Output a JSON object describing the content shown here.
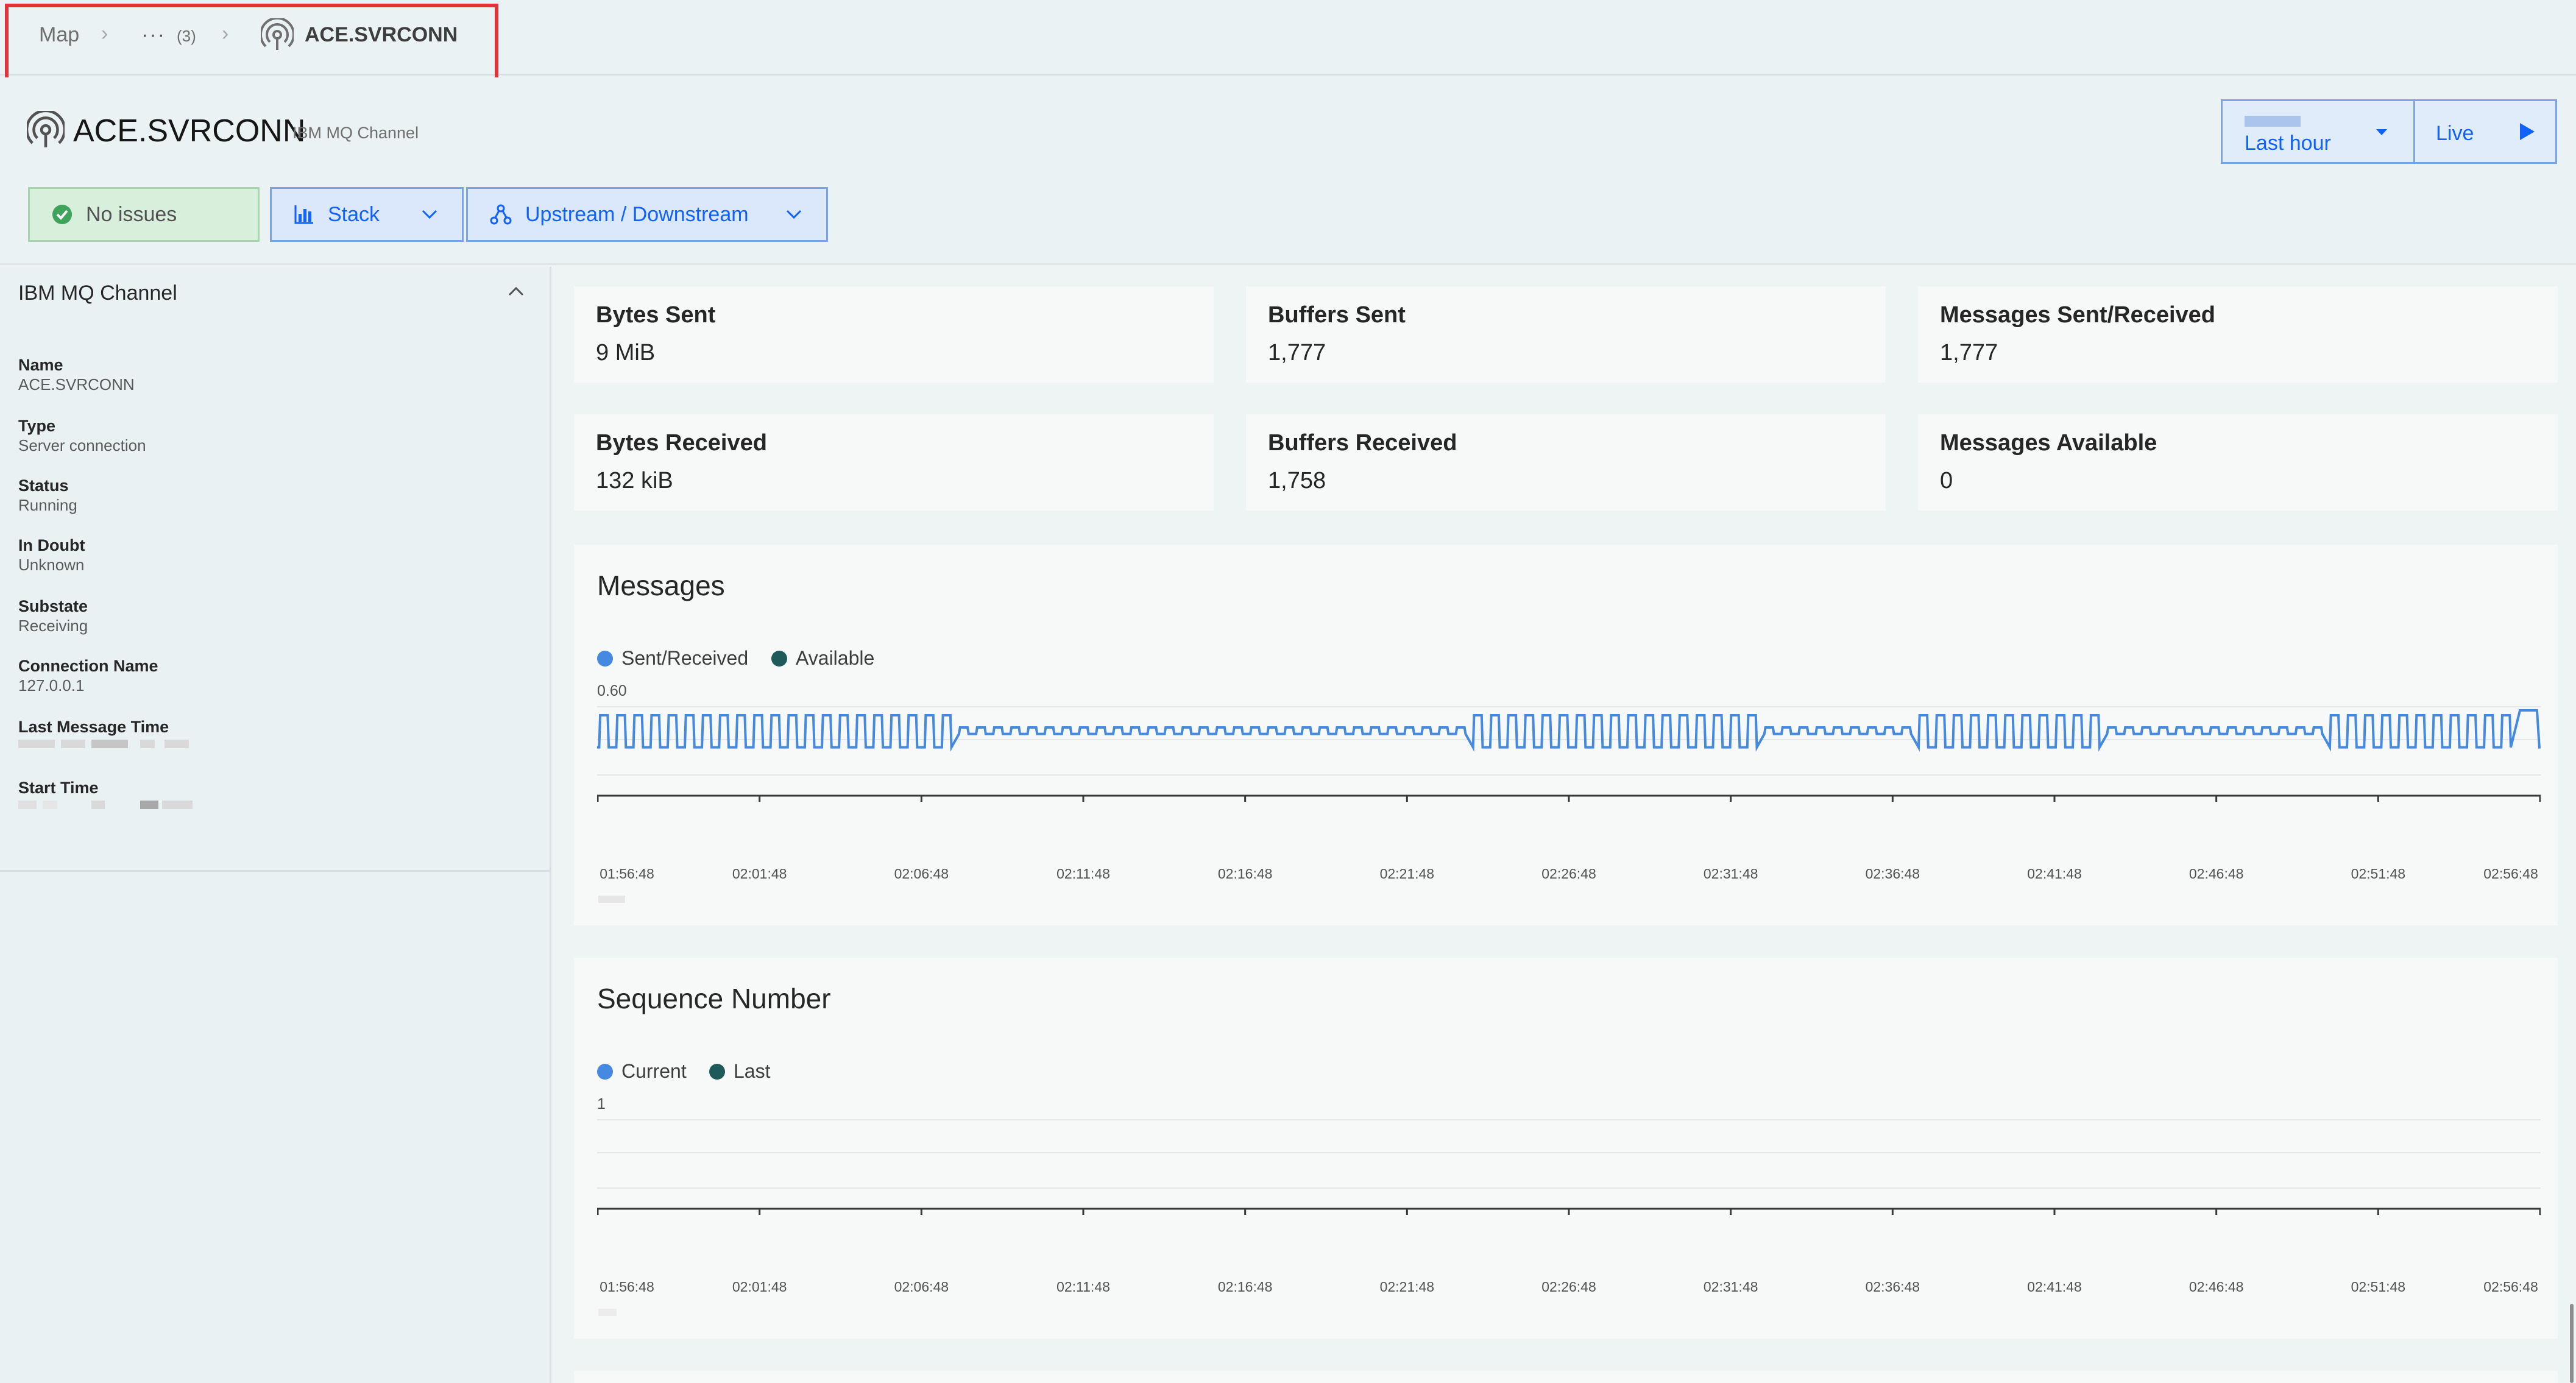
{
  "breadcrumb": {
    "root": "Map",
    "ellipsis": "···",
    "hidden_count": "(3)",
    "current": "ACE.SVRCONN"
  },
  "header": {
    "title": "ACE.SVRCONN",
    "entity_type": "IBM MQ Channel",
    "status_label": "No issues",
    "stack_label": "Stack",
    "updown_label": "Upstream / Downstream",
    "timeframe_label": "Last hour",
    "live_label": "Live"
  },
  "sidebar": {
    "section_title": "IBM MQ Channel",
    "properties": [
      {
        "label": "Name",
        "value": "ACE.SVRCONN"
      },
      {
        "label": "Type",
        "value": "Server connection"
      },
      {
        "label": "Status",
        "value": "Running"
      },
      {
        "label": "In Doubt",
        "value": "Unknown"
      },
      {
        "label": "Substate",
        "value": "Receiving"
      },
      {
        "label": "Connection Name",
        "value": "127.0.0.1"
      },
      {
        "label": "Last Message Time",
        "value": ""
      },
      {
        "label": "Start Time",
        "value": ""
      }
    ]
  },
  "metrics": [
    {
      "label": "Bytes Sent",
      "value": "9 MiB"
    },
    {
      "label": "Buffers Sent",
      "value": "1,777"
    },
    {
      "label": "Messages Sent/Received",
      "value": "1,777"
    },
    {
      "label": "Bytes Received",
      "value": "132 kiB"
    },
    {
      "label": "Buffers Received",
      "value": "1,758"
    },
    {
      "label": "Messages Available",
      "value": "0"
    }
  ],
  "colors": {
    "series_blue": "#4589e0",
    "series_teal": "#1f5a5a",
    "accent_blue": "#0f62fe",
    "ok_green": "#3fa35b",
    "highlight_red": "#e0343a"
  },
  "chart_data": [
    {
      "type": "line",
      "title": "Messages",
      "legend": [
        "Sent/Received",
        "Available"
      ],
      "y_tick_label": "0.60",
      "ylim": [
        0,
        0.6
      ],
      "x_ticks": [
        "01:56:48",
        "02:01:48",
        "02:06:48",
        "02:11:48",
        "02:16:48",
        "02:21:48",
        "02:26:48",
        "02:31:48",
        "02:36:48",
        "02:41:48",
        "02:46:48",
        "02:51:48",
        "02:56:48"
      ],
      "series": [
        {
          "name": "Sent/Received",
          "pattern": "square-wave",
          "high": 0.6,
          "low": 0.4,
          "low_segments": [
            [
              0.18,
              0.45
            ],
            [
              0.6,
              0.68
            ],
            [
              0.78,
              0.9
            ]
          ],
          "rises_to_end": true
        },
        {
          "name": "Available",
          "values": "constant-zero"
        }
      ],
      "grid": true,
      "legend_position": "top-left"
    },
    {
      "type": "line",
      "title": "Sequence Number",
      "legend": [
        "Current",
        "Last"
      ],
      "y_tick_label": "1",
      "x_ticks": [
        "01:56:48",
        "02:01:48",
        "02:06:48",
        "02:11:48",
        "02:16:48",
        "02:21:48",
        "02:26:48",
        "02:31:48",
        "02:36:48",
        "02:41:48",
        "02:46:48",
        "02:51:48",
        "02:56:48"
      ],
      "series": [
        {
          "name": "Current",
          "values": []
        },
        {
          "name": "Last",
          "values": []
        }
      ],
      "grid": true,
      "legend_position": "top-left"
    }
  ]
}
